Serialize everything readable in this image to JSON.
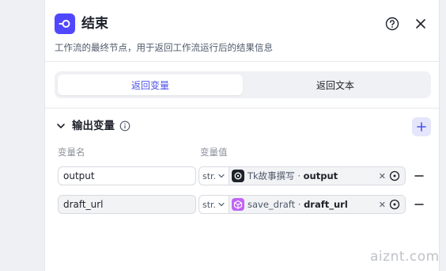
{
  "header": {
    "title": "结束",
    "description": "工作流的最终节点，用于返回工作流运行后的结果信息"
  },
  "tabs": [
    {
      "label": "返回变量",
      "active": true
    },
    {
      "label": "返回文本",
      "active": false
    }
  ],
  "section": {
    "title": "输出变量",
    "col_name": "变量名",
    "col_value": "变量值"
  },
  "rows": [
    {
      "name": "output",
      "type": "str.",
      "source_node": "Tk故事撰写",
      "separator": " · ",
      "source_var": "output",
      "icon": "chatgpt-icon"
    },
    {
      "name": "draft_url",
      "type": "str.",
      "source_node": "save_draft",
      "separator": " · ",
      "source_var": "draft_url",
      "icon": "cube-icon"
    }
  ],
  "watermark": "aiznt.com",
  "colors": {
    "accent": "#4d53e8",
    "node_icon_bg": "#5147ff",
    "plugin_icon_bg": "#c063f5"
  }
}
